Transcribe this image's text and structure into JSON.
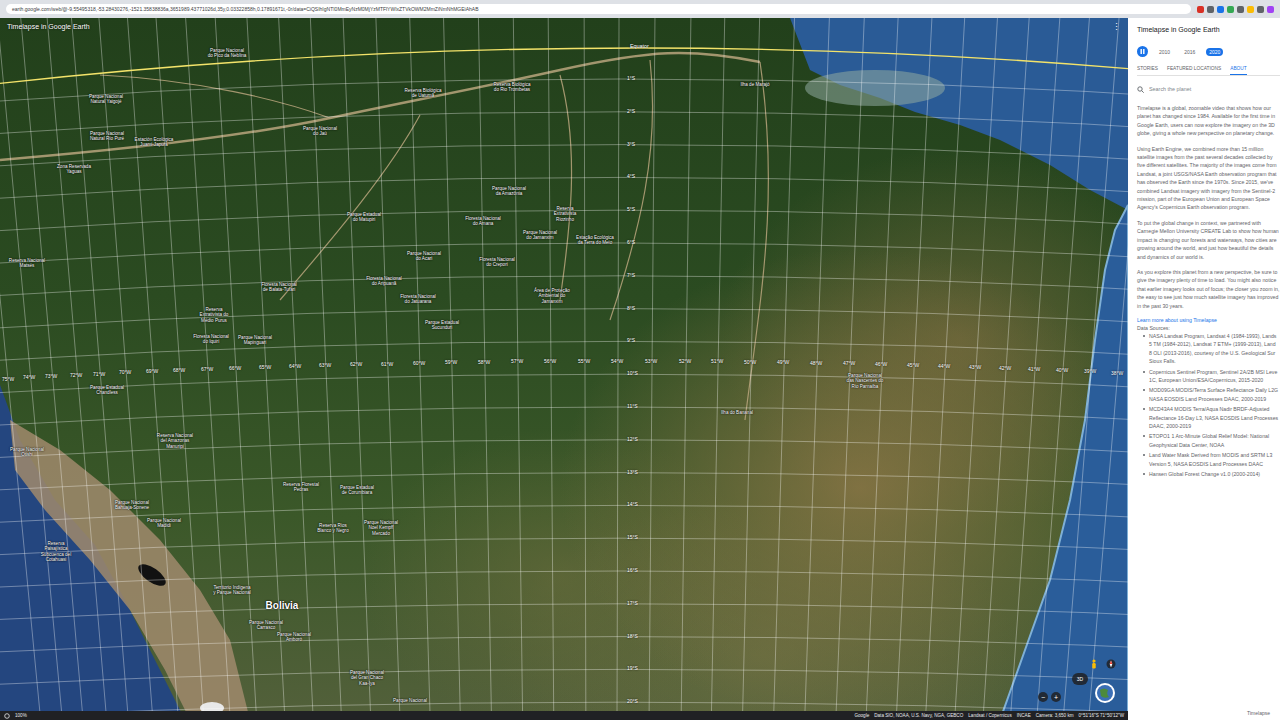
{
  "browser": {
    "url": "earth.google.com/web/@-9.55495318,-53.28430276,-1521.35838836a,3651989.43771026d,35y,0.03322858h,0.17891671t,-0r/data=CiQSIhIgNTI0MmEyNzM0MjYzMTFlYWIxZTVkOWM2MmZiNmNhMGEiAhAB"
  },
  "map": {
    "title": "Timelapse in Google Earth",
    "menu": "⋮",
    "equator": "Equator",
    "places": [
      {
        "text": "Parque Nacional do Pico da Neblina",
        "kind": "park"
      },
      {
        "text": "Parque Nacional Natural Yaigojé",
        "kind": "park"
      },
      {
        "text": "Parque Nacional Natural Río Puré",
        "kind": "park"
      },
      {
        "text": "Estación Ecológica Juami-Japurá",
        "kind": "park"
      },
      {
        "text": "Zona Reservada Yaguas",
        "kind": "park"
      },
      {
        "text": "Parque Nacional do Jaú",
        "kind": "park"
      },
      {
        "text": "Reserva Biológica de Uatumã",
        "kind": "park"
      },
      {
        "text": "Reserva Biológica do Rio Trombetas",
        "kind": "park"
      },
      {
        "text": "Parque Nacional da Amazônia",
        "kind": "park"
      },
      {
        "text": "Reserva Extrativista Riozinho",
        "kind": "park"
      },
      {
        "text": "Floresta Nacional do Amana",
        "kind": "park"
      },
      {
        "text": "Parque Nacional do Jamanxim",
        "kind": "park"
      },
      {
        "text": "Estação Ecológica da Terra do Meio",
        "kind": "park"
      },
      {
        "text": "Parque Estadual do Matupiri",
        "kind": "park"
      },
      {
        "text": "Parque Nacional do Acari",
        "kind": "park"
      },
      {
        "text": "Floresta Nacional do Crepori",
        "kind": "park"
      },
      {
        "text": "Floresta Nacional de Balata-Tufari",
        "kind": "park"
      },
      {
        "text": "Floresta Nacional do Aripuanã",
        "kind": "park"
      },
      {
        "text": "Floresta Nacional do Jatuarana",
        "kind": "park"
      },
      {
        "text": "Área de Proteção Ambiental do Jamanxim",
        "kind": "park"
      },
      {
        "text": "Parque Estadual Sucunduri",
        "kind": "park"
      },
      {
        "text": "Reserva Extrativista do Médio Purus",
        "kind": "park"
      },
      {
        "text": "Floresta Nacional do Iquiri",
        "kind": "park"
      },
      {
        "text": "Parque Nacional Mapinguari",
        "kind": "park"
      },
      {
        "text": "Reserva Nacional Matsés",
        "kind": "park"
      },
      {
        "text": "Parque Estadual Chandless",
        "kind": "park"
      },
      {
        "text": "Reserva Nacional del Amazonas Manuripi",
        "kind": "park"
      },
      {
        "text": "Parque Nacional Otishi",
        "kind": "park"
      },
      {
        "text": "Reserva Florestal Pedras",
        "kind": "park"
      },
      {
        "text": "Parque Estadual de Corumbiara",
        "kind": "park"
      },
      {
        "text": "Parque Nacional Bahuaja-Sonene",
        "kind": "park"
      },
      {
        "text": "Parque Nacional Madidi",
        "kind": "park"
      },
      {
        "text": "Reserva Ríos Blanco y Negro",
        "kind": "park"
      },
      {
        "text": "Parque Nacional Noel Kempff Mercado",
        "kind": "park"
      },
      {
        "text": "Reserva Paisajística Subcuenca del Cotahuasi",
        "kind": "park"
      },
      {
        "text": "Territorio Indígena y Parque Nacional",
        "kind": "park"
      },
      {
        "text": "Bolivia",
        "kind": "country"
      },
      {
        "text": "Parque Nacional Carrasco",
        "kind": "park"
      },
      {
        "text": "Parque Nacional Amboró",
        "kind": "park"
      },
      {
        "text": "Parque Nacional del Gran Chaco Kaa-Iya",
        "kind": "park"
      },
      {
        "text": "Parque Nacional das Nascentes do Rio Parnaíba",
        "kind": "park"
      },
      {
        "text": "Ilha de Marajó",
        "kind": "place"
      },
      {
        "text": "Ilha do Bananal",
        "kind": "place"
      },
      {
        "text": "Parque Nacional",
        "kind": "park"
      }
    ],
    "latitudes": [
      "1°S",
      "2°S",
      "3°S",
      "4°S",
      "5°S",
      "6°S",
      "7°S",
      "8°S",
      "9°S",
      "10°S",
      "11°S",
      "12°S",
      "13°S",
      "14°S",
      "15°S",
      "16°S",
      "17°S",
      "18°S",
      "19°S",
      "20°S"
    ],
    "longitudes": [
      "75°W",
      "74°W",
      "73°W",
      "72°W",
      "71°W",
      "70°W",
      "69°W",
      "68°W",
      "67°W",
      "66°W",
      "65°W",
      "64°W",
      "63°W",
      "62°W",
      "61°W",
      "60°W",
      "59°W",
      "58°W",
      "57°W",
      "56°W",
      "55°W",
      "54°W",
      "53°W",
      "52°W",
      "51°W",
      "50°W",
      "49°W",
      "48°W",
      "47°W",
      "46°W",
      "45°W",
      "44°W",
      "43°W",
      "42°W",
      "41°W",
      "40°W",
      "39°W",
      "38°W"
    ],
    "controls": {
      "view": "3D",
      "zoom_out": "−",
      "zoom_in": "+"
    },
    "zoom": "100%",
    "attribution": [
      "Google",
      "Data SIO, NOAA, U.S. Navy, NGA, GEBCO",
      "Landsat / Copernicus",
      "INCAE",
      "Camera: 3,650 km",
      "0°51'16\"S 71°50'12\"W"
    ]
  },
  "panel": {
    "title": "Timelapse in Google Earth",
    "playing": true,
    "years": [
      {
        "label": "2010",
        "selected": false
      },
      {
        "label": "2016",
        "selected": false
      },
      {
        "label": "2020",
        "selected": true
      }
    ],
    "tabs": [
      {
        "label": "STORIES",
        "selected": false
      },
      {
        "label": "FEATURED LOCATIONS",
        "selected": false
      },
      {
        "label": "ABOUT",
        "selected": true
      }
    ],
    "search": {
      "placeholder": "Search the planet"
    },
    "paragraphs": [
      [
        "Timelapse is a global, zoomable video that shows how our",
        "planet has changed since 1984. Available for the first time in",
        "Google Earth, users can now explore the imagery on the 3D",
        "globe, giving a whole new perspective on planetary change."
      ],
      [
        "Using Earth Engine, we combined more than 15 million",
        "satellite images from the past several decades collected by",
        "five different satellites. The majority of the images come from",
        "Landsat, a joint USGS/NASA Earth observation program that",
        "has observed the Earth since the 1970s. Since 2015, we've",
        "combined Landsat imagery with imagery from the Sentinel-2",
        "mission, part of the European Union and European Space",
        "Agency's Copernicus Earth observation program."
      ],
      [
        "To put the global change in context, we partnered with",
        "Carnegie Mellon University CREATE Lab to show how human",
        "impact is changing our forests and waterways, how cities are",
        "growing around the world, and just how beautiful the details",
        "and dynamics of our world is."
      ],
      [
        "As you explore this planet from a new perspective, be sure to",
        "give the imagery plenty of time to load. You might also notice",
        "that earlier imagery looks out of focus; the closer you zoom in,",
        "the easy to see just how much satellite imagery has improved",
        "in the past 30 years."
      ]
    ],
    "link": "Learn more about using Timelapse",
    "sources_title": "Data Sources:",
    "sources": [
      [
        "NASA Landsat Program, Landsat 4 (1984-1993), Lands",
        "5 TM (1984-2012), Landsat 7 ETM+ (1999-2013), Land",
        "8 OLI (2013-2016), courtesy of the U.S. Geological Sur",
        "Sioux Falls."
      ],
      [
        "Copernicus Sentinel Program, Sentinel 2A/2B MSI Leve",
        "1C, European Union/ESA/Copernicus, 2015-2020"
      ],
      [
        "MOD09GA MODIS/Terra Surface Reflectance Daily L2G",
        "NASA EOSDIS Land Processes DAAC, 2000-2019"
      ],
      [
        "MCD43A4 MODIS Terra/Aqua Nadir BRDF-Adjusted",
        "Reflectance 16-Day L3, NASA EOSDIS Land Processes",
        "DAAC, 2000-2019"
      ],
      [
        "ETOPO1 1 Arc-Minute Global Relief Model: National",
        "Geophysical Data Center, NOAA"
      ],
      [
        "Land Water Mask Derived from MODIS and SRTM L3",
        "Version 5, NASA EOSDIS Land Processes DAAC"
      ],
      [
        "Hansen Global Forest Change v1.0 (2000-2014)"
      ]
    ],
    "footer": "Timelapse"
  }
}
